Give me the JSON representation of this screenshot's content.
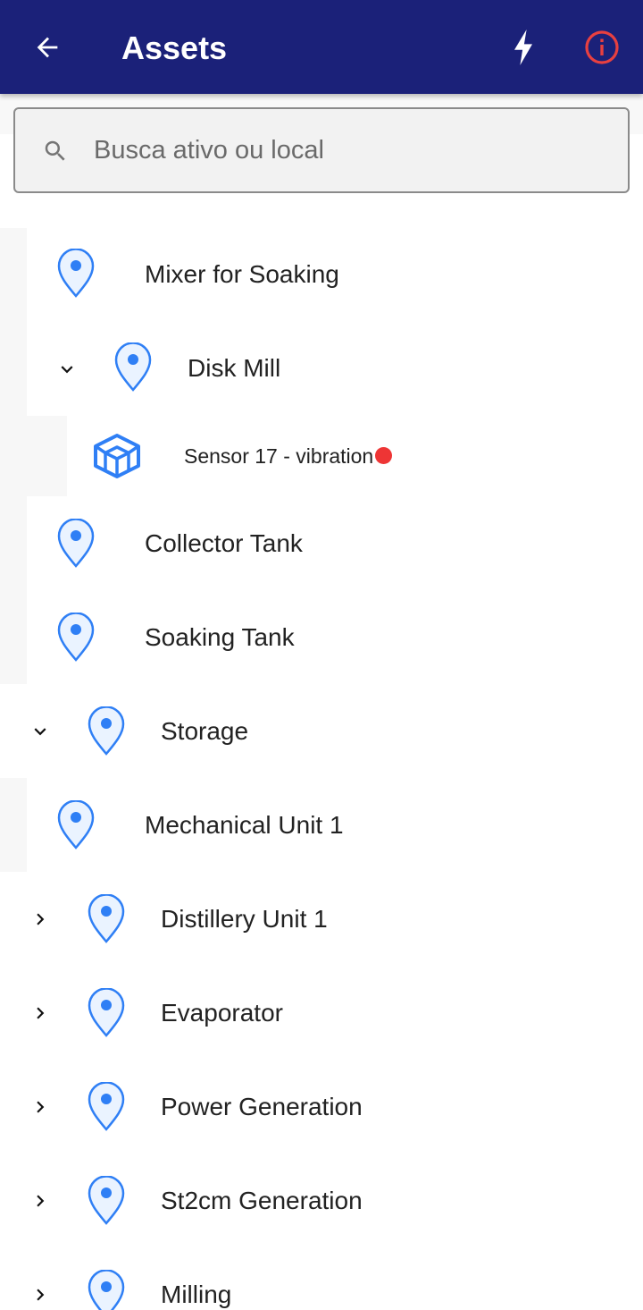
{
  "appbar": {
    "title": "Assets",
    "back_icon": "arrow-left-icon",
    "action_icons": [
      "bolt-icon",
      "info-icon"
    ],
    "background_color": "#1b2179",
    "info_icon_color": "#e84040"
  },
  "search": {
    "placeholder": "Busca ativo ou local",
    "value": ""
  },
  "tree": {
    "pin_color": "#2f7ff5",
    "alert_color": "#ee3535",
    "items": [
      {
        "label": "Mixer for Soaking",
        "type": "location"
      },
      {
        "label": "Disk Mill",
        "type": "location",
        "expanded": true
      },
      {
        "label": "Sensor 17 - vibration",
        "type": "component",
        "status": "alert"
      },
      {
        "label": "Collector Tank",
        "type": "location"
      },
      {
        "label": "Soaking Tank",
        "type": "location"
      },
      {
        "label": "Storage",
        "type": "location",
        "expanded": true
      },
      {
        "label": "Mechanical Unit 1",
        "type": "location"
      },
      {
        "label": "Distillery Unit 1",
        "type": "location",
        "expanded": false
      },
      {
        "label": "Evaporator",
        "type": "location",
        "expanded": false
      },
      {
        "label": "Power Generation",
        "type": "location",
        "expanded": false
      },
      {
        "label": "St2cm Generation",
        "type": "location",
        "expanded": false
      },
      {
        "label": "Milling",
        "type": "location",
        "expanded": false
      }
    ]
  }
}
